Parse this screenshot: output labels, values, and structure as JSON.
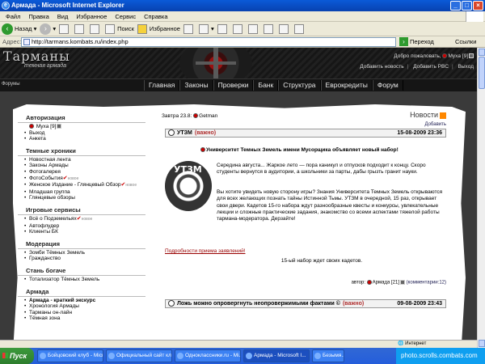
{
  "window": {
    "title": "Армада - Microsoft Internet Explorer"
  },
  "menu": [
    "Файл",
    "Правка",
    "Вид",
    "Избранное",
    "Сервис",
    "Справка"
  ],
  "toolbar": {
    "back": "Назад",
    "search": "Поиск",
    "favorites": "Избранное"
  },
  "address": {
    "label": "Адрес:",
    "url": "http://tarmans.kombats.ru/index.php",
    "go": "Переход",
    "links": "Ссылки"
  },
  "site": {
    "logo": "Тарманы",
    "logo_sub": "темная армада",
    "welcome": "Добро пожаловать,",
    "user": "Муха [9]",
    "links": [
      "Добавить новость",
      "Добавить PBC",
      "Выход"
    ],
    "forums": "Форумы",
    "nav": [
      "Главная",
      "Законы",
      "Проверки",
      "Банк",
      "Структура",
      "Еврокредиты",
      "Форум"
    ]
  },
  "sidebar": {
    "auth": {
      "title": "Авторизация",
      "user": "Муха [9]",
      "items": [
        "Выход",
        "Анкета"
      ]
    },
    "chronicles": {
      "title": "Темные хроники",
      "items": [
        "Новостная лента",
        "Законы Армады",
        "Фотогалерея",
        "ФотоСобытия",
        "Женское Издание - Глянцевый Обзор",
        "Младшая группа",
        "Глянцевые обзоры"
      ],
      "new_label": "новое"
    },
    "games": {
      "title": "Игровые сервисы",
      "items": [
        "Всё о Подземельях",
        "Автофлудер",
        "Клиенты БК"
      ]
    },
    "moderation": {
      "title": "Модерация",
      "items": [
        "Зомби Тёмных Земель",
        "Гражданство"
      ]
    },
    "rich": {
      "title": "Стань богаче",
      "items": [
        "Тотализатор Тёмных Земель"
      ]
    },
    "armada": {
      "title": "Армада",
      "items": [
        "Армада - краткий экскурс",
        "Хронология Армады",
        "Тарманы он-лайн",
        "Тёмная зона"
      ]
    }
  },
  "content": {
    "tomorrow": "Завтра 23.8:",
    "tomorrow_user": "Getman",
    "news": "Новости",
    "add": "Добавить",
    "post1": {
      "title": "УТЗМ",
      "important": "(важно)",
      "date": "15-08-2009 23:36",
      "lead": "Университет Темных Земель имени Мусорщика объявляет новый набор!",
      "p1": "Середина августа... Жаркое лето — пора каникул и отпусков подходит к концу. Скоро студенты вернутся в аудитории, а школьники за парты, дабы грызть гранит науки.",
      "p2": "Вы хотите увидеть новую сторону игры? Знания Университета Темных Земель открываются для всех желающих познать тайны Истинной Тьмы. УТЗМ в очередной, 15 раз, открывает свои двери. Кадетов 15-го набора ждут разнообразные квесты и конкурсы, увлекательные лекции и сложные практические задания, знакомство со всеми аспектами тяжелой работы тармана-модератора. Дерзайте!",
      "link": "Подробности приема заявлений!",
      "p3": "15-ый набор ждет своих кадетов.",
      "author_label": "автор:",
      "author": "Армада [21]",
      "comments": "(комментарии:12)"
    },
    "post2": {
      "title": "Ложь можно опровергнуть неопровержимыми фактами ©",
      "important": "(важно)",
      "date": "09-08-2009 23:43"
    }
  },
  "status": {
    "zone": "Интернет"
  },
  "taskbar": {
    "start": "Пуск",
    "tasks": [
      "Бойцовский клуб - Micr...",
      "Официальный сайт кла...",
      "Одноклассники.ru - Mi...",
      "Армада - Microsoft I...",
      "Безымя..."
    ],
    "tray": "photo.scrolls.combats.com"
  }
}
